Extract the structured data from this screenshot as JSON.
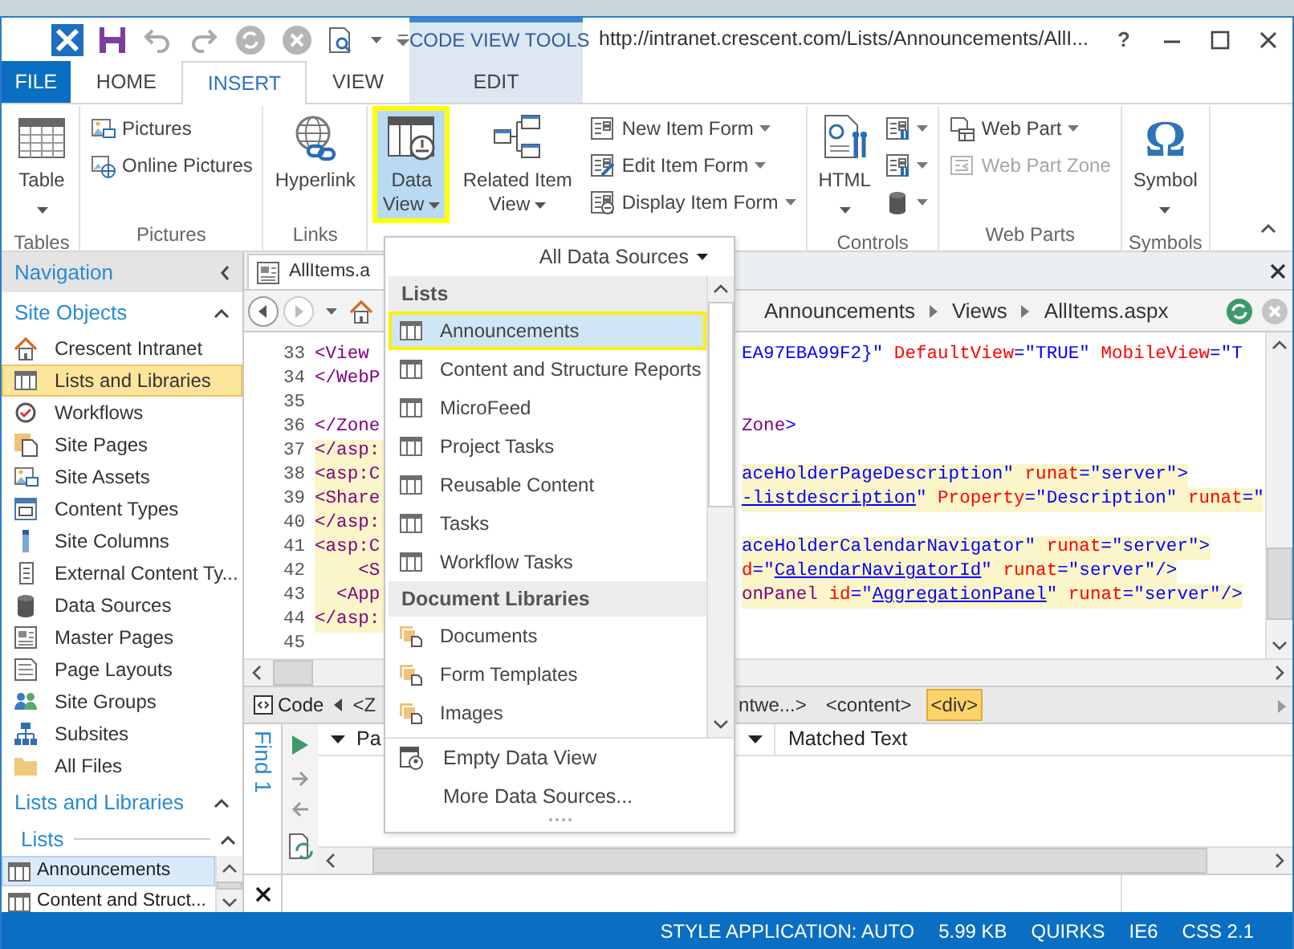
{
  "title_bar": {
    "contextual_group": "CODE VIEW TOOLS",
    "title": "http://intranet.crescent.com/Lists/Announcements/AllI...",
    "help": "?"
  },
  "ribbon_tabs": [
    {
      "label": "FILE",
      "kind": "file",
      "selected": false
    },
    {
      "label": "HOME",
      "kind": "normal",
      "selected": false
    },
    {
      "label": "INSERT",
      "kind": "normal",
      "selected": true
    },
    {
      "label": "VIEW",
      "kind": "normal",
      "selected": false
    },
    {
      "label": "EDIT",
      "kind": "contextual",
      "selected": false
    }
  ],
  "ribbon_groups": [
    {
      "label": "Tables",
      "controls": [
        {
          "kind": "large",
          "label": "Table",
          "dropdown": true,
          "pressed": false,
          "disabled": false
        }
      ]
    },
    {
      "label": "Pictures",
      "controls": [
        {
          "kind": "small",
          "label": "Pictures",
          "dropdown": false,
          "pressed": false,
          "disabled": false
        },
        {
          "kind": "small",
          "label": "Online Pictures",
          "dropdown": false,
          "pressed": false,
          "disabled": false
        }
      ]
    },
    {
      "label": "Links",
      "controls": [
        {
          "kind": "large",
          "label": "Hyperlink",
          "dropdown": false,
          "pressed": false,
          "disabled": false
        }
      ]
    },
    {
      "controls": [
        {
          "kind": "large",
          "label": "Data View",
          "dropdown": true,
          "pressed": true,
          "disabled": false
        },
        {
          "kind": "large",
          "label": "Related Item View",
          "dropdown": true,
          "pressed": false,
          "disabled": false
        },
        {
          "kind": "small",
          "label": "New Item Form",
          "dropdown": true,
          "pressed": false,
          "disabled": false
        },
        {
          "kind": "small",
          "label": "Edit Item Form",
          "dropdown": true,
          "pressed": false,
          "disabled": false
        },
        {
          "kind": "small",
          "label": "Display Item Form",
          "dropdown": true,
          "pressed": false,
          "disabled": false
        }
      ]
    },
    {
      "label": "Controls",
      "controls": [
        {
          "kind": "large",
          "label": "HTML",
          "dropdown": true,
          "pressed": false,
          "disabled": false
        },
        {
          "kind": "small",
          "dropdown": true,
          "pressed": false,
          "disabled": false
        },
        {
          "kind": "small",
          "dropdown": true,
          "pressed": false,
          "disabled": false
        },
        {
          "kind": "small",
          "dropdown": true,
          "pressed": false,
          "disabled": false
        }
      ]
    },
    {
      "label": "Web Parts",
      "controls": [
        {
          "kind": "small",
          "label": "Web Part",
          "dropdown": true,
          "pressed": false,
          "disabled": false
        },
        {
          "kind": "small",
          "label": "Web Part Zone",
          "dropdown": false,
          "pressed": false,
          "disabled": true
        }
      ]
    },
    {
      "label": "Symbols",
      "controls": [
        {
          "kind": "large",
          "label": "Symbol",
          "glyph": "Ω",
          "dropdown": true,
          "pressed": false,
          "disabled": false
        }
      ]
    }
  ],
  "navigation": {
    "header": "Navigation",
    "sections": [
      {
        "title": "Site Objects",
        "expanded": true,
        "items": [
          {
            "label": "Crescent Intranet",
            "selected": false
          },
          {
            "label": "Lists and Libraries",
            "selected": true
          },
          {
            "label": "Workflows",
            "selected": false
          },
          {
            "label": "Site Pages",
            "selected": false
          },
          {
            "label": "Site Assets",
            "selected": false
          },
          {
            "label": "Content Types",
            "selected": false
          },
          {
            "label": "Site Columns",
            "selected": false
          },
          {
            "label": "External Content Ty...",
            "selected": false
          },
          {
            "label": "Data Sources",
            "selected": false
          },
          {
            "label": "Master Pages",
            "selected": false
          },
          {
            "label": "Page Layouts",
            "selected": false
          },
          {
            "label": "Site Groups",
            "selected": false
          },
          {
            "label": "Subsites",
            "selected": false
          },
          {
            "label": "All Files",
            "selected": false
          }
        ]
      },
      {
        "title": "Lists and Libraries",
        "expanded": true,
        "subsections": [
          {
            "title": "Lists",
            "expanded": true,
            "items": [
              {
                "label": "Announcements",
                "selected": true
              },
              {
                "label": "Content and Struct...",
                "selected": false
              }
            ]
          }
        ]
      }
    ]
  },
  "editor": {
    "document_tab": "AllItems.a",
    "breadcrumb": [
      "Announcements",
      "Views",
      "AllItems.aspx"
    ],
    "code_lines": [
      {
        "number": "33",
        "left": "<View",
        "highlighted": false,
        "right": [
          {
            "kind": "value",
            "text": "EA97EBA99F2}\""
          },
          {
            "kind": "attr",
            "text": " DefaultView"
          },
          {
            "kind": "punct",
            "text": "="
          },
          {
            "kind": "value",
            "text": "\"TRUE\""
          },
          {
            "kind": "attr",
            "text": " MobileView"
          },
          {
            "kind": "punct",
            "text": "="
          },
          {
            "kind": "value",
            "text": "\"T"
          }
        ]
      },
      {
        "number": "34",
        "left": "</WebP",
        "highlighted": false
      },
      {
        "number": "35",
        "highlighted": false
      },
      {
        "number": "36",
        "left": "</Zone",
        "highlighted": false,
        "right": [
          {
            "kind": "tag",
            "text": "Zone"
          },
          {
            "kind": "punct",
            "text": ">"
          }
        ]
      },
      {
        "number": "37",
        "left": "</asp:",
        "highlighted": true
      },
      {
        "number": "38",
        "left": "<asp:C",
        "highlighted": true,
        "right": [
          {
            "kind": "value",
            "text": "aceHolderPageDescription\""
          },
          {
            "kind": "attr",
            "text": " runat"
          },
          {
            "kind": "punct",
            "text": "="
          },
          {
            "kind": "value",
            "text": "\"server\""
          },
          {
            "kind": "punct",
            "text": ">"
          }
        ]
      },
      {
        "number": "39",
        "left": "<Share",
        "highlighted": true,
        "right": [
          {
            "kind": "link",
            "text": "-listdescription"
          },
          {
            "kind": "value",
            "text": "\""
          },
          {
            "kind": "attr",
            "text": " Property"
          },
          {
            "kind": "punct",
            "text": "="
          },
          {
            "kind": "value",
            "text": "\"Description\""
          },
          {
            "kind": "attr",
            "text": " runat"
          },
          {
            "kind": "punct",
            "text": "="
          },
          {
            "kind": "value",
            "text": "\""
          }
        ]
      },
      {
        "number": "40",
        "left": "</asp:",
        "highlighted": true
      },
      {
        "number": "41",
        "left": "<asp:C",
        "highlighted": true,
        "right": [
          {
            "kind": "value",
            "text": "aceHolderCalendarNavigator\""
          },
          {
            "kind": "attr",
            "text": " runat"
          },
          {
            "kind": "punct",
            "text": "="
          },
          {
            "kind": "value",
            "text": "\"server\""
          },
          {
            "kind": "punct",
            "text": ">"
          }
        ]
      },
      {
        "number": "42",
        "left": "    <S",
        "highlighted": true,
        "right": [
          {
            "kind": "attr",
            "text": "d"
          },
          {
            "kind": "punct",
            "text": "="
          },
          {
            "kind": "value",
            "text": "\""
          },
          {
            "kind": "link",
            "text": "CalendarNavigatorId"
          },
          {
            "kind": "value",
            "text": "\""
          },
          {
            "kind": "attr",
            "text": " runat"
          },
          {
            "kind": "punct",
            "text": "="
          },
          {
            "kind": "value",
            "text": "\"server\""
          },
          {
            "kind": "punct",
            "text": "/>"
          }
        ]
      },
      {
        "number": "43",
        "left": "  <App",
        "highlighted": true,
        "right": [
          {
            "kind": "tag",
            "text": "onPanel"
          },
          {
            "kind": "attr",
            "text": " id"
          },
          {
            "kind": "punct",
            "text": "="
          },
          {
            "kind": "value",
            "text": "\""
          },
          {
            "kind": "link",
            "text": "AggregationPanel"
          },
          {
            "kind": "value",
            "text": "\""
          },
          {
            "kind": "attr",
            "text": " runat"
          },
          {
            "kind": "punct",
            "text": "="
          },
          {
            "kind": "value",
            "text": "\"server\""
          },
          {
            "kind": "punct",
            "text": "/>"
          }
        ]
      },
      {
        "number": "44",
        "left": "</asp:",
        "highlighted": true
      },
      {
        "number": "45",
        "highlighted": false
      }
    ],
    "tag_bar": {
      "mode": "Code",
      "left_tags": [
        {
          "label": "<Z",
          "selected": false
        }
      ],
      "right_tags": [
        {
          "label": "ntwe...>",
          "selected": false
        },
        {
          "label": "<content>",
          "selected": false
        },
        {
          "label": "<div>",
          "selected": true
        }
      ]
    },
    "find_panel": {
      "title": "Find 1",
      "columns": [
        "Pa",
        "Matched Text"
      ]
    }
  },
  "data_source_menu": {
    "filter": "All Data Sources",
    "sections": [
      {
        "title": "Lists",
        "kind": "list",
        "items": [
          {
            "label": "Announcements",
            "selected": true
          },
          {
            "label": "Content and Structure Reports",
            "selected": false
          },
          {
            "label": "MicroFeed",
            "selected": false
          },
          {
            "label": "Project Tasks",
            "selected": false
          },
          {
            "label": "Reusable Content",
            "selected": false
          },
          {
            "label": "Tasks",
            "selected": false
          },
          {
            "label": "Workflow Tasks",
            "selected": false
          }
        ]
      },
      {
        "title": "Document Libraries",
        "kind": "library",
        "items": [
          {
            "label": "Documents",
            "selected": false
          },
          {
            "label": "Form Templates",
            "selected": false
          },
          {
            "label": "Images",
            "selected": false
          }
        ]
      }
    ],
    "actions": [
      "Empty Data View",
      "More Data Sources..."
    ]
  },
  "status_bar": [
    "STYLE APPLICATION: AUTO",
    "5.99 KB",
    "QUIRKS",
    "IE6",
    "CSS 2.1"
  ]
}
